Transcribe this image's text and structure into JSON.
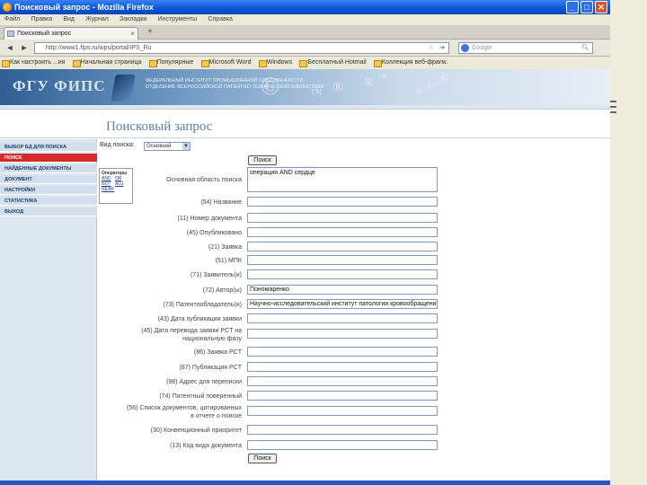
{
  "window": {
    "title": "Поисковый запрос - Mozilla Firefox",
    "buttons": [
      "_",
      "□",
      "✕"
    ]
  },
  "menubar": [
    "Файл",
    "Правка",
    "Вид",
    "Журнал",
    "Закладки",
    "Инструменты",
    "Справка"
  ],
  "tabs": {
    "active_label": "Поисковый запрос",
    "close": "×",
    "new_tab": "+"
  },
  "navbar": {
    "back": "◄",
    "forward": "►",
    "url": "http://www1.fips.ru/wps/portal/IPS_Ru",
    "star": "☆",
    "go": "➜",
    "search_placeholder": "Google",
    "search_icon": "magnifier-icon"
  },
  "bookmarks": [
    "Как настроить ...ия",
    "Начальная страница",
    "Популярные",
    "Microsoft Word",
    "Windows",
    "Бесплатный Hotmail",
    "Коллекция веб-фрагм."
  ],
  "site": {
    "logo": "ФГУ ФИПС",
    "subtitle_line1": "ФЕДЕРАЛЬНЫЙ ИНСТИТУТ ПРОМЫШЛЕННОЙ СОБСТВЕННОСТИ",
    "subtitle_line2": "ОТДЕЛЕНИЕ ВСЕРОССИЙСКОЙ ПАТЕНТНО-ТЕХНИЧЕСКОЙ БИБЛИОТЕКИ",
    "watermarks": [
      "©",
      "®",
      "™",
      "©",
      "®",
      "™",
      "©",
      "®"
    ]
  },
  "page_title": "Поисковый запрос",
  "leftnav": {
    "items": [
      {
        "label": "ВЫБОР БД ДЛЯ ПОИСКА",
        "active": false
      },
      {
        "label": "ПОИСК",
        "active": true
      },
      {
        "label": "НАЙДЕННЫЕ ДОКУМЕНТЫ",
        "active": false
      },
      {
        "label": "ДОКУМЕНТ",
        "active": false
      },
      {
        "label": "НАСТРОЙКИ",
        "active": false
      },
      {
        "label": "СТАТИСТИКА",
        "active": false
      },
      {
        "label": "ВЫХОД",
        "active": false
      }
    ]
  },
  "operators": {
    "title": "Операторы",
    "items": [
      "AND",
      "OR",
      "NOT",
      "ADJ",
      "NEAR"
    ]
  },
  "form": {
    "search_type_label": "Вид поиска:",
    "search_type_value": "Основной",
    "search_button": "Поиск",
    "main_query_label": "Основная область поиска",
    "main_query_value": "операция AND сердце",
    "fields": [
      {
        "label": "(54) Название",
        "value": ""
      },
      {
        "label": "(11) Номер документа",
        "value": ""
      },
      {
        "label": "(45) Опубликовано",
        "value": ""
      },
      {
        "label": "(21) Заявка",
        "value": ""
      },
      {
        "label": "(51) МПК",
        "value": ""
      },
      {
        "label": "(71) Заявитель(и)",
        "value": ""
      },
      {
        "label": "(72) Автор(ы)",
        "value": "Пономаренко"
      },
      {
        "label": "(73) Патентообладатель(и)",
        "value": "Научно-исследовательский институт патологии кровообращения"
      },
      {
        "label": "(43) Дата публикации заявки",
        "value": ""
      },
      {
        "label_line1": "(45) Дата перевода заявки PCT на",
        "label_line2": "национальную фазу",
        "value": ""
      },
      {
        "label": "(86) Заявка PCT",
        "value": ""
      },
      {
        "label": "(87) Публикация PCT",
        "value": ""
      },
      {
        "label": "(98) Адрес для переписки",
        "value": ""
      },
      {
        "label": "(74) Патентный поверенный",
        "value": ""
      },
      {
        "label_line1": "(56) Список документов, цитированных",
        "label_line2": "в отчете о поиске",
        "value": ""
      },
      {
        "label": "(30) Конвенционный приоритет",
        "value": ""
      },
      {
        "label": "(13) Код вида документа",
        "value": ""
      }
    ],
    "bottom_button": "Поиск"
  }
}
